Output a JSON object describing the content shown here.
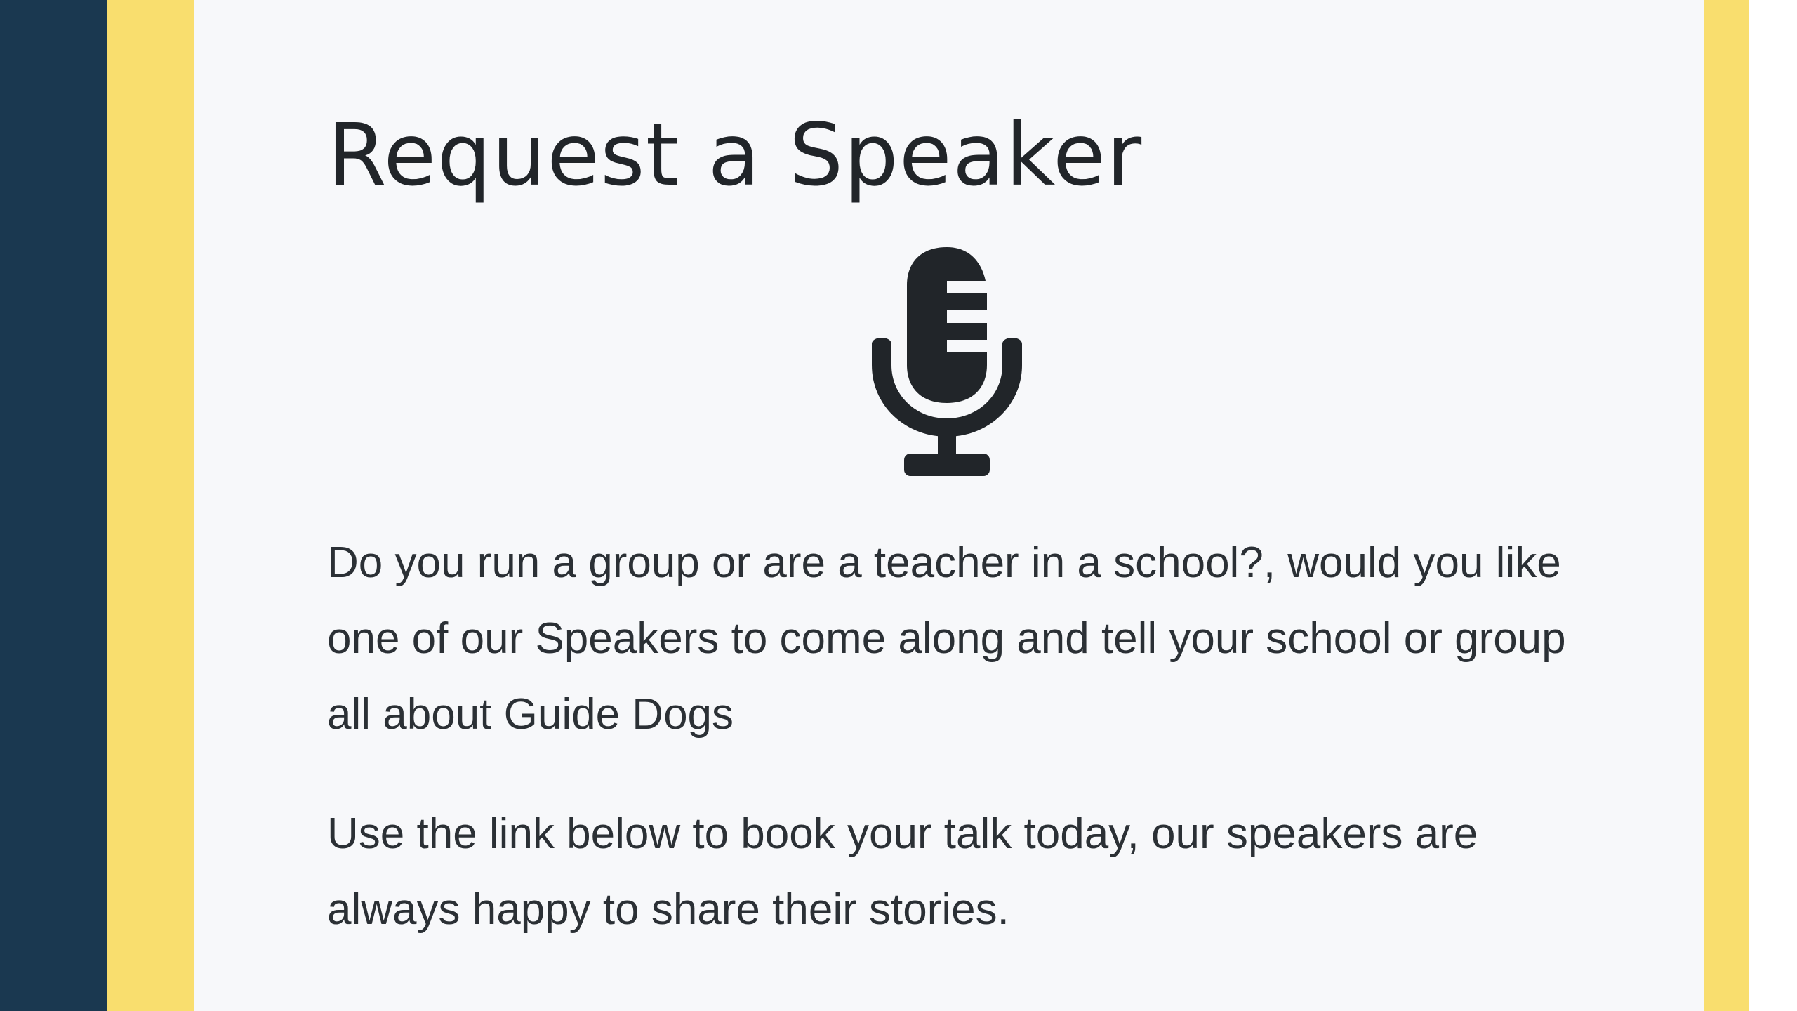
{
  "colors": {
    "sidebar": "#1a3850",
    "accent_yellow": "#f9de6e",
    "card_background": "#f7f8fa",
    "text": "#212529"
  },
  "card": {
    "title": "Request a Speaker",
    "icon": "microphone-icon",
    "paragraphs": [
      "Do you run a group or are a teacher in a school?, would you like one of our Speakers to come along and tell your school or group all about Guide Dogs",
      "Use the link below to book your talk today, our speakers are always happy to share their stories."
    ]
  }
}
